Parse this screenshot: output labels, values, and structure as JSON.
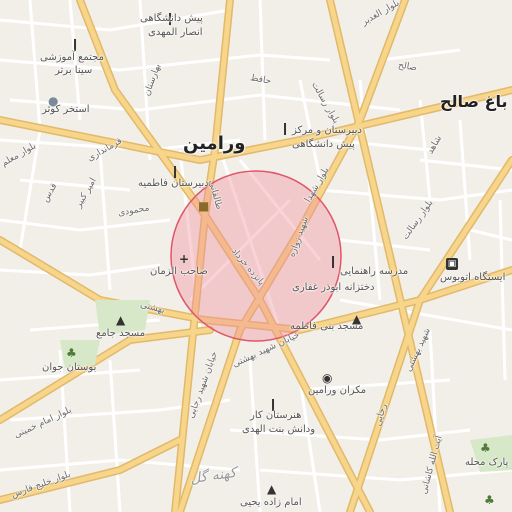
{
  "labels": {
    "city_main": "ورامین",
    "village": "باغ صالح",
    "kohneh_gol": "کهنه گل",
    "pish_daneshgahi_ansar_1": "پیش دانشگاهی",
    "pish_daneshgahi_ansar_2": "انصار المهدی",
    "majtama_1": "مجتمع آموزشی",
    "majtama_2": "سینا برتر",
    "estakhr": "استخر کوثر",
    "dabirestan_fatemeh": "دبیرستان فاطمیه",
    "dabirestan_markaz_1": "دبیرستان و مرکز",
    "dabirestan_markaz_2": "پیش دانشگاهی",
    "madreseh_1": "مدرسه راهنمایی",
    "madreseh_2": "دختزانه ابوذر غفاری",
    "masjed_bani_fatemeh": "مسجد بنی فاطمه",
    "masjed_jame": "مسجد جامع",
    "bostan_javan": "بوستان جوان",
    "sahebo_zaman": "صاحب الزمان",
    "istgah_1": "ایستگاه اتوبوس",
    "mekran": "مکران ورامین",
    "honarestan_1": "هنرستان کار",
    "honarestan_2": "ودانش بنت الهدی",
    "emamzadeh": "امام زاده یحیی",
    "park_mahaleh": "پارک محله",
    "bostan_top": "بوستان"
  },
  "streets": {
    "ghadir": "بلوار الغدیر",
    "saleh": "صالح",
    "hafez": "حافظ",
    "resalat": "بلوار رسالت",
    "shahid_beheshti": "خیابان شهید بهشتی",
    "taleghani": "طالقانی",
    "shohada": "بلوار شهدا",
    "shahid_zaveh": "شهید زواره",
    "khordad": "پانزده خرداد",
    "baharestan": "بهارستان",
    "emam_khomeini": "بلوار امام خمینی",
    "khalij_fars": "بلوار خلیج فارس",
    "beheshti": "بهشتی",
    "shahid_rajaei": "خیابان شهید رجایی",
    "ayatollah": "آیت الله کاشانی",
    "mahmoudi": "محمودی",
    "amir_kabir": "امیر کبیر",
    "farmandari": "فرمانداری",
    "moallem": "بلوار معلم",
    "ghods": "قدس",
    "kaveh": "کاوه",
    "shahed": "شاهد",
    "rajaei_2": "رجایی",
    "shahid_beheshti_2": "شهید بهشتی"
  },
  "icons": {
    "school": "school-icon",
    "mosque": "mosque-icon",
    "hospital": "hospital-icon",
    "bus": "bus-station-icon",
    "park": "park-icon",
    "shopping": "shopping-icon",
    "taxi": "taxi-icon"
  },
  "colors": {
    "land": "#f2efe9",
    "major_road": "#f7d58a",
    "road_outline": "#e2b96a",
    "minor_road": "#ffffff",
    "highlight_fill": "#f28b9a",
    "highlight_stroke": "#e0566b",
    "park": "#d6e8c8"
  }
}
